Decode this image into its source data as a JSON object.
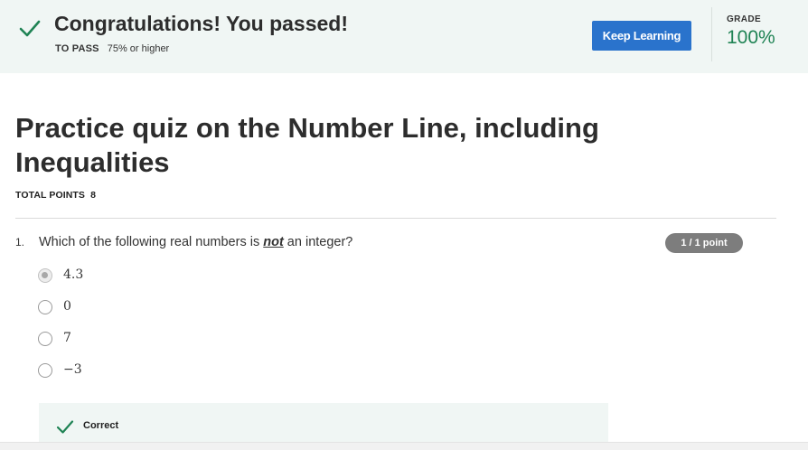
{
  "banner": {
    "status_icon": "check-icon",
    "title": "Congratulations! You passed!",
    "pass_label": "TO PASS",
    "pass_value": "75% or higher",
    "keep_learning_label": "Keep Learning",
    "grade_label": "GRADE",
    "grade_value": "100%",
    "accent_color": "#1f8354",
    "button_color": "#2a73cc"
  },
  "quiz": {
    "title": "Practice quiz on the Number Line, including Inequalities",
    "total_points_label": "TOTAL POINTS",
    "total_points_value": "8"
  },
  "question": {
    "number": "1.",
    "text_before": "Which of the following real numbers is ",
    "text_emphasis": "not",
    "text_after": " an integer?",
    "points": "1 / 1 point",
    "options": [
      {
        "label": "4.3",
        "selected": true
      },
      {
        "label": "0",
        "selected": false
      },
      {
        "label": "7",
        "selected": false
      },
      {
        "label": "−3",
        "selected": false
      }
    ],
    "feedback": {
      "icon": "check-icon",
      "label": "Correct"
    }
  }
}
